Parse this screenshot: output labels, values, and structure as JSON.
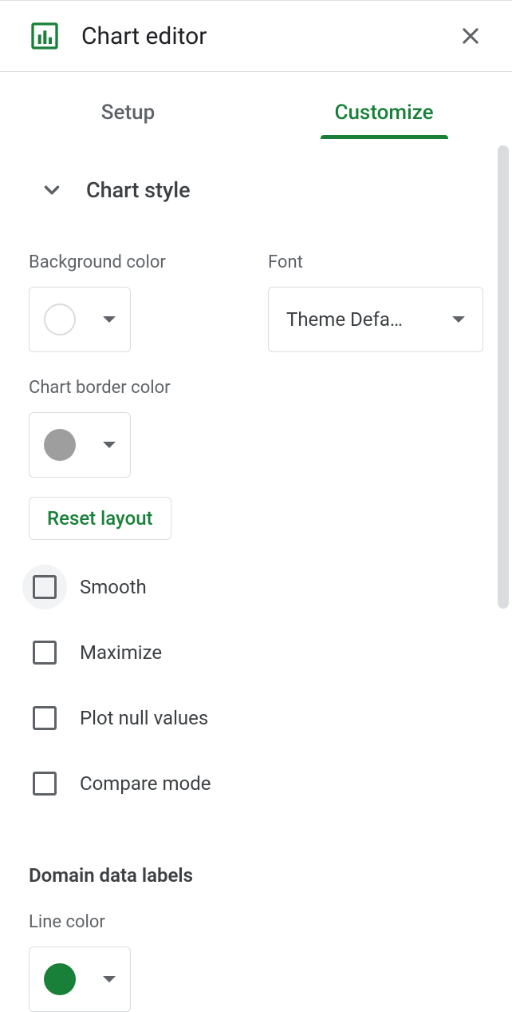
{
  "header": {
    "title": "Chart editor"
  },
  "tabs": {
    "setup": "Setup",
    "customize": "Customize",
    "active": "customize"
  },
  "section": {
    "chart_style": "Chart style"
  },
  "fields": {
    "bg_color_label": "Background color",
    "font_label": "Font",
    "font_value": "Theme Defa…",
    "border_color_label": "Chart border color",
    "reset_layout": "Reset layout",
    "line_color_label": "Line color"
  },
  "checkboxes": {
    "smooth": "Smooth",
    "maximize": "Maximize",
    "plot_null": "Plot null values",
    "compare": "Compare mode"
  },
  "groups": {
    "domain_data_labels": "Domain data labels"
  },
  "colors": {
    "bg": "#ffffff",
    "border": "#9e9e9e",
    "line": "#188038"
  }
}
